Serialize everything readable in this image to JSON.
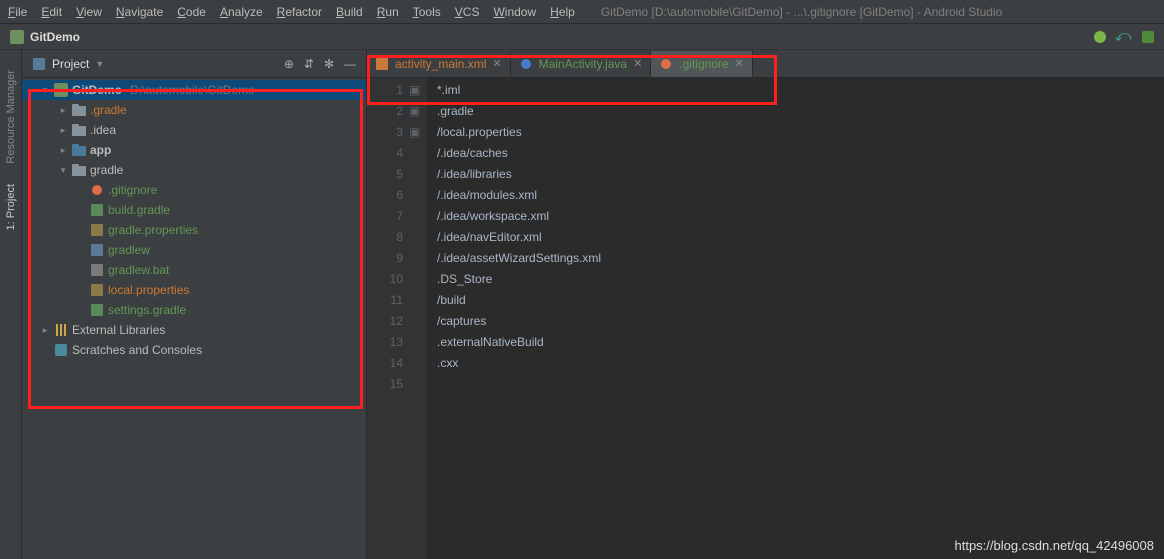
{
  "menu": [
    "File",
    "Edit",
    "View",
    "Navigate",
    "Code",
    "Analyze",
    "Refactor",
    "Build",
    "Run",
    "Tools",
    "VCS",
    "Window",
    "Help"
  ],
  "window_title": "GitDemo [D:\\automobile\\GitDemo] - ...\\.gitignore [GitDemo] - Android Studio",
  "breadcrumb": "GitDemo",
  "panel": {
    "title": "Project",
    "tool_icons": [
      "target-icon",
      "collapse-icon",
      "gear-icon",
      "hide-icon"
    ]
  },
  "left_gutter": [
    "Resource Manager",
    "1: Project"
  ],
  "tree": [
    {
      "indent": 0,
      "arrow": "▾",
      "icon": "project-icon",
      "label": "GitDemo",
      "hint": "D:\\automobile\\GitDemo",
      "selected": true,
      "cls": "bold"
    },
    {
      "indent": 1,
      "arrow": "▸",
      "icon": "folder-icon",
      "label": ".gradle",
      "cls": "orange"
    },
    {
      "indent": 1,
      "arrow": "▸",
      "icon": "folder-icon",
      "label": ".idea",
      "cls": ""
    },
    {
      "indent": 1,
      "arrow": "▸",
      "icon": "module-icon",
      "label": "app",
      "cls": "bold"
    },
    {
      "indent": 1,
      "arrow": "▾",
      "icon": "folder-icon",
      "label": "gradle",
      "cls": ""
    },
    {
      "indent": 2,
      "arrow": "",
      "icon": "git-icon",
      "label": ".gitignore",
      "cls": "green"
    },
    {
      "indent": 2,
      "arrow": "",
      "icon": "gradle-icon",
      "label": "build.gradle",
      "cls": "green"
    },
    {
      "indent": 2,
      "arrow": "",
      "icon": "props-icon",
      "label": "gradle.properties",
      "cls": "green"
    },
    {
      "indent": 2,
      "arrow": "",
      "icon": "sh-icon",
      "label": "gradlew",
      "cls": "green"
    },
    {
      "indent": 2,
      "arrow": "",
      "icon": "bat-icon",
      "label": "gradlew.bat",
      "cls": "green"
    },
    {
      "indent": 2,
      "arrow": "",
      "icon": "props-icon",
      "label": "local.properties",
      "cls": "orange"
    },
    {
      "indent": 2,
      "arrow": "",
      "icon": "gradle-icon",
      "label": "settings.gradle",
      "cls": "green"
    },
    {
      "indent": 0,
      "arrow": "▸",
      "icon": "lib-icon",
      "label": "External Libraries",
      "cls": ""
    },
    {
      "indent": 0,
      "arrow": "",
      "icon": "scratch-icon",
      "label": "Scratches and Consoles",
      "cls": ""
    }
  ],
  "tabs": [
    {
      "name": "activity_main.xml",
      "icon": "xml-icon",
      "cls": "orange",
      "active": false
    },
    {
      "name": "MainActivity.java",
      "icon": "java-icon",
      "cls": "green",
      "active": false
    },
    {
      "name": ".gitignore",
      "icon": "git-icon",
      "cls": "green",
      "active": true
    }
  ],
  "code_lines": [
    "*.iml",
    ".gradle",
    "/local.properties",
    "/.idea/caches",
    "/.idea/libraries",
    "/.idea/modules.xml",
    "/.idea/workspace.xml",
    "/.idea/navEditor.xml",
    "/.idea/assetWizardSettings.xml",
    ".DS_Store",
    "/build",
    "/captures",
    ".externalNativeBuild",
    ".cxx",
    ""
  ],
  "fold_marks": {
    "2": "▣",
    "4": "▣",
    "5": "▣"
  },
  "watermark": "https://blog.csdn.net/qq_42496008"
}
